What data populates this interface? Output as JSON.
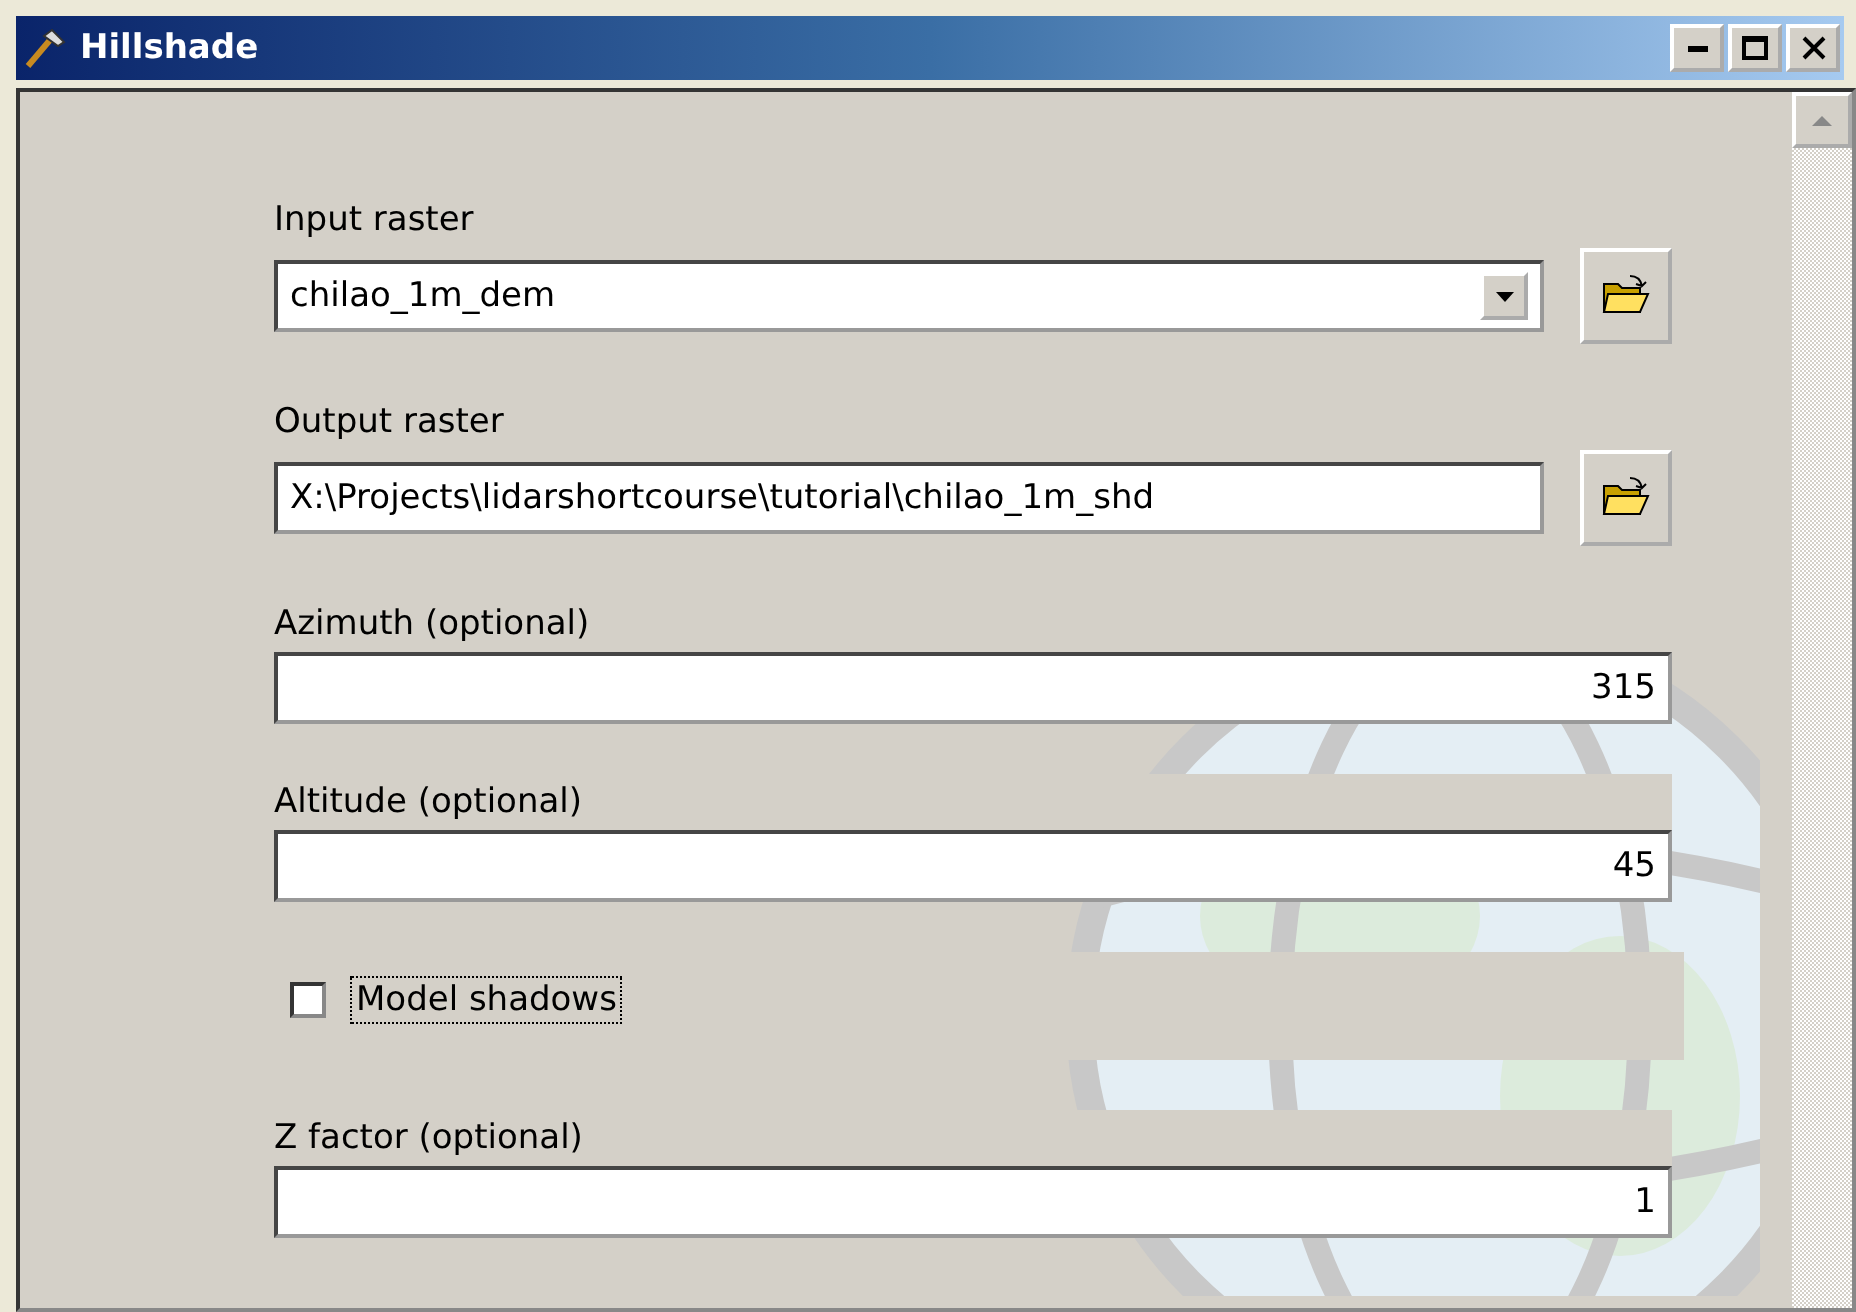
{
  "window": {
    "title": "Hillshade"
  },
  "parameters": [
    {
      "kind": "dropdown",
      "label": "Input raster",
      "value": "chilao_1m_dem"
    },
    {
      "kind": "path",
      "label": "Output raster",
      "value": "X:\\Projects\\lidarshortcourse\\tutorial\\chilao_1m_shd"
    },
    {
      "kind": "number",
      "label": "Azimuth (optional)",
      "value": "315"
    },
    {
      "kind": "number",
      "label": "Altitude (optional)",
      "value": "45"
    },
    {
      "kind": "checkbox",
      "label": "Model shadows",
      "checked": false,
      "focused": true
    },
    {
      "kind": "number",
      "label": "Z factor (optional)",
      "value": "1"
    }
  ]
}
